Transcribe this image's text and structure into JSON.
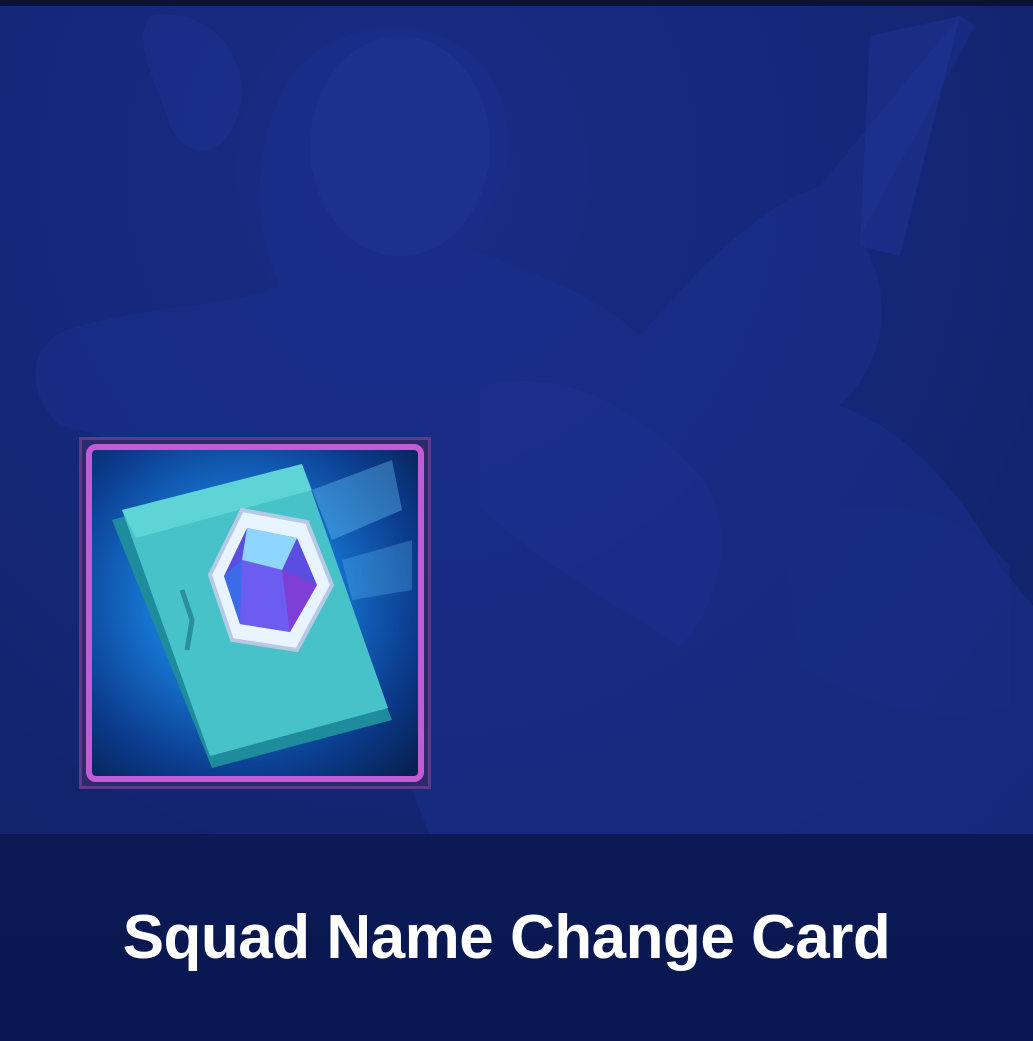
{
  "item": {
    "name": "Squad Name Change Card",
    "icon": "gem-card-icon",
    "frame_color": "#c25bd6"
  },
  "background": {
    "art": "hero-silhouette-art",
    "tint": "#13267a"
  }
}
